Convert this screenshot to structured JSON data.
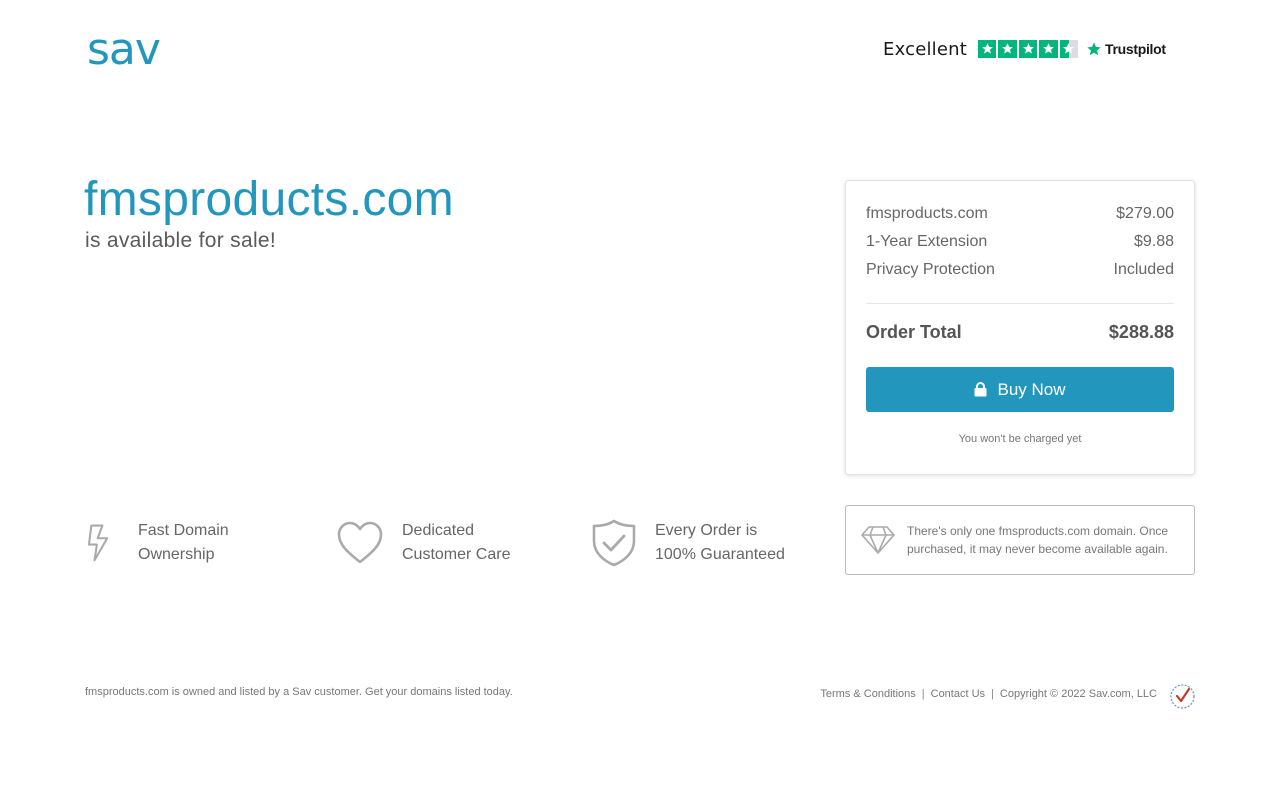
{
  "brand": {
    "logo_text": "sav",
    "accent": "#2396bd"
  },
  "trustpilot": {
    "rating_word": "Excellent",
    "stars": 4.5,
    "brand": "Trustpilot"
  },
  "hero": {
    "domain": "fmsproducts.com",
    "subtitle": "is available for sale!"
  },
  "order": {
    "lines": [
      {
        "label": "fmsproducts.com",
        "value": "$279.00"
      },
      {
        "label": "1-Year Extension",
        "value": "$9.88"
      },
      {
        "label": "Privacy Protection",
        "value": "Included"
      }
    ],
    "total_label": "Order Total",
    "total_value": "$288.88",
    "buy_label": "Buy Now",
    "note": "You won't be charged yet"
  },
  "features": [
    {
      "icon": "lightning-icon",
      "line1": "Fast Domain",
      "line2": "Ownership"
    },
    {
      "icon": "heart-icon",
      "line1": "Dedicated",
      "line2": "Customer Care"
    },
    {
      "icon": "shield-check-icon",
      "line1": "Every Order is",
      "line2": "100% Guaranteed"
    }
  ],
  "unique": {
    "icon": "diamond-icon",
    "line1": "There's only one fmsproducts.com domain. Once",
    "line2": "purchased, it may never become available again."
  },
  "footer": {
    "left": "fmsproducts.com is owned and listed by a Sav customer. Get your domains listed today.",
    "terms": "Terms & Conditions",
    "contact": "Contact Us",
    "copyright": "Copyright © 2022 Sav.com, LLC",
    "separator": "|"
  }
}
